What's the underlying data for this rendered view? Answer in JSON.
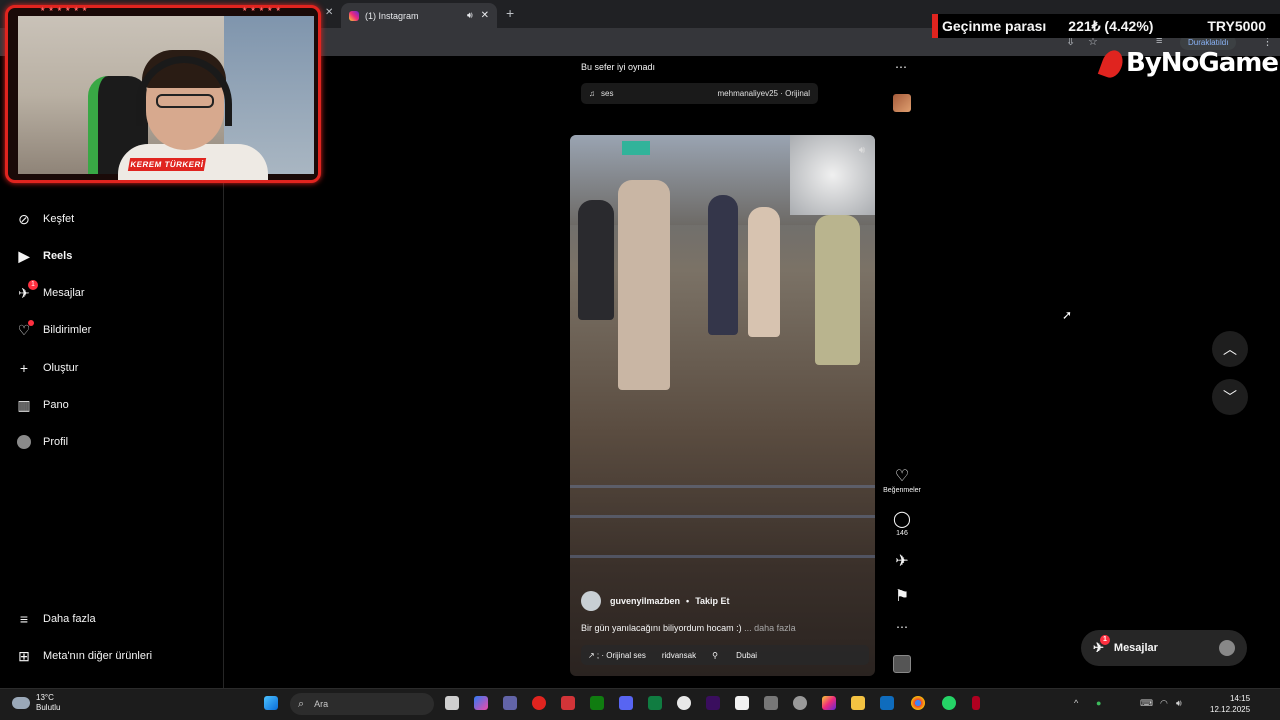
{
  "browser": {
    "tab_title": "(1) Instagram",
    "tab_close": "✕",
    "new_tab": "+",
    "paused_label": "Duraklatıldı"
  },
  "stream": {
    "webcam_name": "KEREM TÜRKERİ",
    "ticker_label": "Geçinme parası",
    "ticker_value": "221₺ (4.42%)",
    "ticker_code": "TRY5000",
    "logo": "ByNoGame"
  },
  "sidebar": {
    "items": [
      {
        "label": "Keşfet",
        "icon": "compass-icon"
      },
      {
        "label": "Reels",
        "icon": "reels-icon"
      },
      {
        "label": "Mesajlar",
        "icon": "messenger-icon",
        "badge": "1"
      },
      {
        "label": "Bildirimler",
        "icon": "heart-icon"
      },
      {
        "label": "Oluştur",
        "icon": "plus-icon"
      },
      {
        "label": "Pano",
        "icon": "dashboard-icon"
      },
      {
        "label": "Profil",
        "icon": "avatar-icon"
      }
    ],
    "more": "Daha fazla",
    "meta": "Meta'nın diğer ürünleri"
  },
  "post_top": {
    "caption": "Bu sefer iyi oynadı",
    "audio_label": "ses",
    "audio_source": "mehmanaliyev25 · Orijinal"
  },
  "reel": {
    "username": "guvenyilmazben",
    "follow": "Takip Et",
    "caption": "Bir gün yanılacağını biliyordum hocam :)",
    "more": "... daha fazla",
    "chip_audio": "↗ ; · Orijinal ses",
    "chip_user": "ridvansak",
    "chip_location": "Dubai",
    "likes_label": "Beğenmeler",
    "comments_count": "146"
  },
  "messages_pill": {
    "label": "Mesajlar",
    "badge": "1"
  },
  "taskbar": {
    "temp": "13°C",
    "weather": "Bulutlu",
    "search_placeholder": "Ara",
    "time": "14:15",
    "date": "12.12.2025"
  }
}
